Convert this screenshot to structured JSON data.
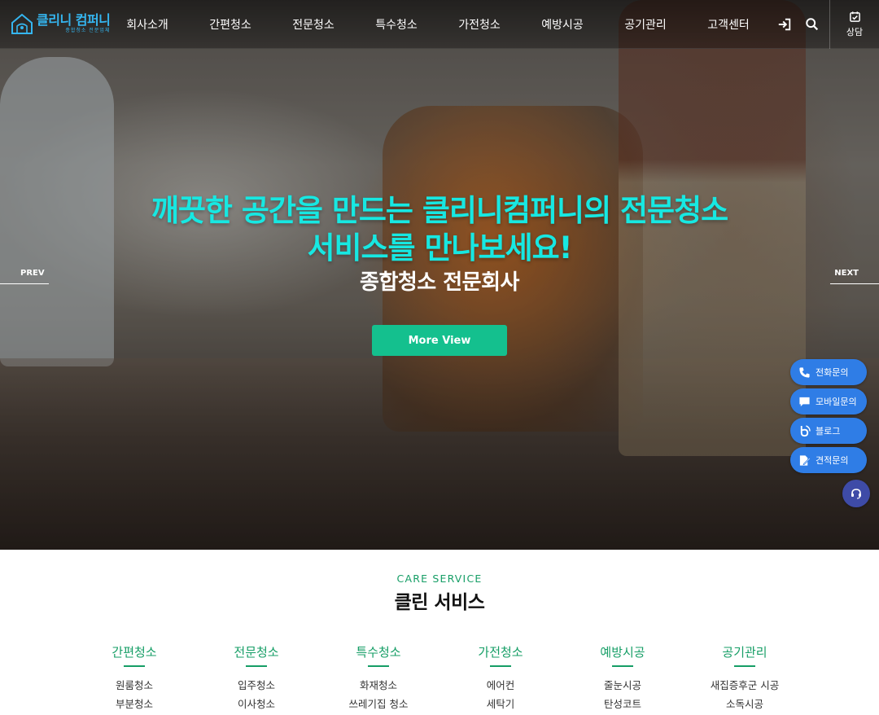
{
  "header": {
    "logo_main": "클리니 컴퍼니",
    "logo_tag": "종합청소 전문업체",
    "nav": [
      "회사소개",
      "간편청소",
      "전문청소",
      "특수청소",
      "가전청소",
      "예방시공",
      "공기관리",
      "고객센터"
    ],
    "consult_label": "상담"
  },
  "hero": {
    "title_line1": "깨끗한 공간을 만드는 클리니컴퍼니의 전문청소",
    "title_line2": "서비스를 만나보세요!",
    "subtitle": "종합청소 전문회사",
    "button": "More View",
    "prev": "PREV",
    "next": "NEXT"
  },
  "quick_menu": [
    "전화문의",
    "모바일문의",
    "블로그",
    "견적문의"
  ],
  "service": {
    "eyebrow": "CARE SERVICE",
    "title": "클린 서비스",
    "columns": [
      {
        "title": "간편청소",
        "items": [
          "원룸청소",
          "부분청소"
        ]
      },
      {
        "title": "전문청소",
        "items": [
          "입주청소",
          "이사청소"
        ]
      },
      {
        "title": "특수청소",
        "items": [
          "화재청소",
          "쓰레기집 청소"
        ]
      },
      {
        "title": "가전청소",
        "items": [
          "에어컨",
          "세탁기"
        ]
      },
      {
        "title": "예방시공",
        "items": [
          "줄눈시공",
          "탄성코트"
        ]
      },
      {
        "title": "공기관리",
        "items": [
          "새집증후군 시공",
          "소독시공"
        ]
      }
    ]
  },
  "colors": {
    "hero_title": "#17e8e2",
    "button_green": "#14c08e",
    "service_green": "#169e66",
    "quick_blue": "#2f7de6",
    "logo_blue": "#35b6f0"
  }
}
